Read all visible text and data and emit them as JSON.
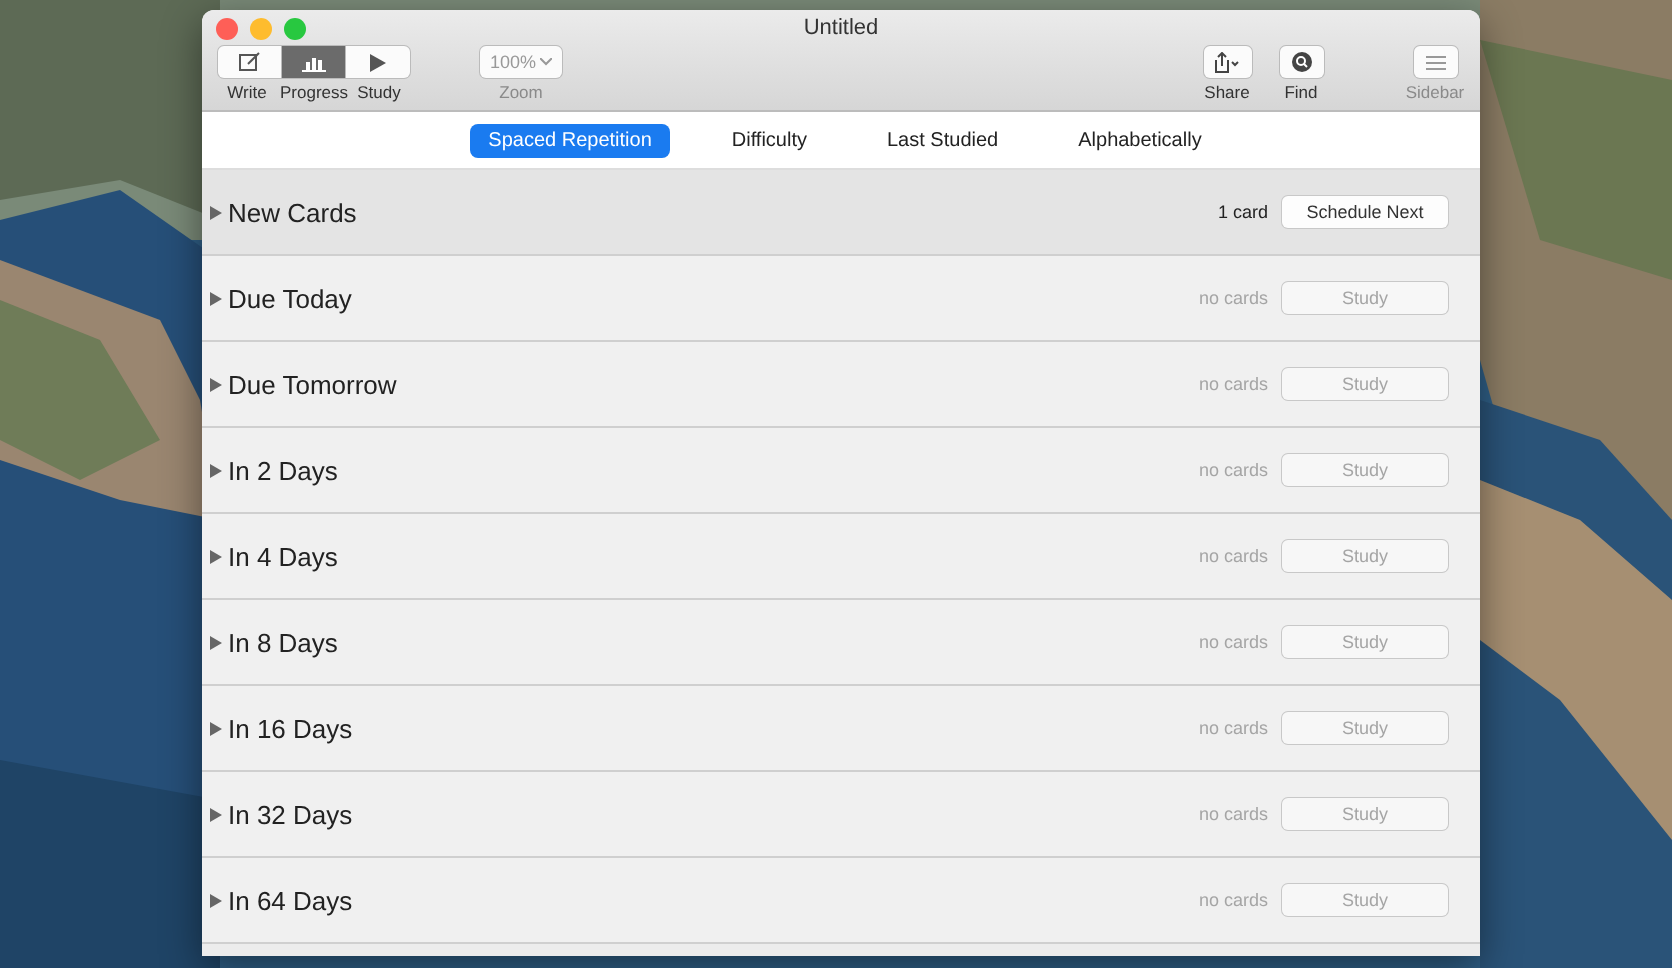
{
  "window": {
    "title": "Untitled"
  },
  "toolbar": {
    "view_modes": [
      {
        "label": "Write",
        "selected": false
      },
      {
        "label": "Progress",
        "selected": true
      },
      {
        "label": "Study",
        "selected": false
      }
    ],
    "zoom": {
      "value": "100%",
      "label": "Zoom",
      "disabled": true
    },
    "share": {
      "label": "Share"
    },
    "find": {
      "label": "Find"
    },
    "sidebar": {
      "label": "Sidebar",
      "disabled": true
    }
  },
  "sort_tabs": [
    {
      "label": "Spaced Repetition",
      "selected": true
    },
    {
      "label": "Difficulty",
      "selected": false
    },
    {
      "label": "Last Studied",
      "selected": false
    },
    {
      "label": "Alphabetically",
      "selected": false
    }
  ],
  "groups": [
    {
      "title": "New Cards",
      "count": "1 card",
      "button": "Schedule Next",
      "disabled": false
    },
    {
      "title": "Due Today",
      "count": "no cards",
      "button": "Study",
      "disabled": true
    },
    {
      "title": "Due Tomorrow",
      "count": "no cards",
      "button": "Study",
      "disabled": true
    },
    {
      "title": "In 2 Days",
      "count": "no cards",
      "button": "Study",
      "disabled": true
    },
    {
      "title": "In 4 Days",
      "count": "no cards",
      "button": "Study",
      "disabled": true
    },
    {
      "title": "In 8 Days",
      "count": "no cards",
      "button": "Study",
      "disabled": true
    },
    {
      "title": "In 16 Days",
      "count": "no cards",
      "button": "Study",
      "disabled": true
    },
    {
      "title": "In 32 Days",
      "count": "no cards",
      "button": "Study",
      "disabled": true
    },
    {
      "title": "In 64 Days",
      "count": "no cards",
      "button": "Study",
      "disabled": true
    }
  ]
}
